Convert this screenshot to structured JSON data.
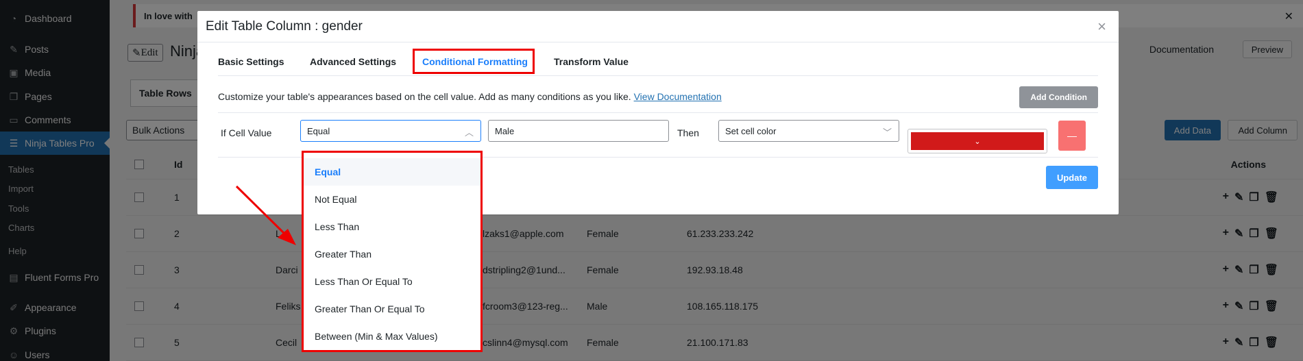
{
  "sidebar": {
    "items": [
      {
        "label": "Dashboard",
        "icon": "dashboard-icon"
      },
      {
        "label": "Posts",
        "icon": "pin-icon"
      },
      {
        "label": "Media",
        "icon": "media-icon"
      },
      {
        "label": "Pages",
        "icon": "pages-icon"
      },
      {
        "label": "Comments",
        "icon": "comments-icon"
      },
      {
        "label": "Ninja Tables Pro",
        "icon": "table-icon"
      },
      {
        "label": "Fluent Forms Pro",
        "icon": "forms-icon"
      },
      {
        "label": "Appearance",
        "icon": "brush-icon"
      },
      {
        "label": "Plugins",
        "icon": "plugin-icon"
      },
      {
        "label": "Users",
        "icon": "users-icon"
      }
    ],
    "subitems": [
      "Tables",
      "Import",
      "Tools",
      "Charts",
      "Help"
    ]
  },
  "page": {
    "notice": "In love with",
    "edit_label": "Edit",
    "title": "Ninja",
    "documentation": "Documentation",
    "preview": "Preview",
    "tab_rows": "Table Rows",
    "bulk_actions": "Bulk Actions",
    "add_data": "Add Data",
    "add_column": "Add Column"
  },
  "table": {
    "headers": {
      "id": "Id",
      "actions": "Actions"
    },
    "rows": [
      {
        "id": "1",
        "name": "",
        "email": "",
        "gender": "",
        "ip": ""
      },
      {
        "id": "2",
        "name": "L",
        "email": "lzaks1@apple.com",
        "gender": "Female",
        "ip": "61.233.233.242"
      },
      {
        "id": "3",
        "name": "Darci",
        "email": "dstripling2@1und...",
        "gender": "Female",
        "ip": "192.93.18.48"
      },
      {
        "id": "4",
        "name": "Feliks",
        "email": "fcroom3@123-reg...",
        "gender": "Male",
        "ip": "108.165.118.175"
      },
      {
        "id": "5",
        "name": "Cecil",
        "email": "cslinn4@mysql.com",
        "gender": "Female",
        "ip": "21.100.171.83"
      }
    ]
  },
  "modal": {
    "title": "Edit Table Column : gender",
    "tabs": [
      "Basic Settings",
      "Advanced Settings",
      "Conditional Formatting",
      "Transform Value"
    ],
    "active_tab": "Conditional Formatting",
    "description": "Customize your table's appearances based on the cell value. Add as many conditions as you like.",
    "doc_link": "View Documentation",
    "add_condition": "Add Condition",
    "if_label": "If Cell Value",
    "operator_value": "Equal",
    "value_input": "Male",
    "then_label": "Then",
    "action_value": "Set cell color",
    "cell_color": "#d11a1a",
    "remove_symbol": "—",
    "update": "Update"
  },
  "dropdown": {
    "selected": "Equal",
    "options": [
      "Equal",
      "Not Equal",
      "Less Than",
      "Greater Than",
      "Less Than Or Equal To",
      "Greater Than Or Equal To",
      "Between (Min & Max Values)"
    ]
  }
}
